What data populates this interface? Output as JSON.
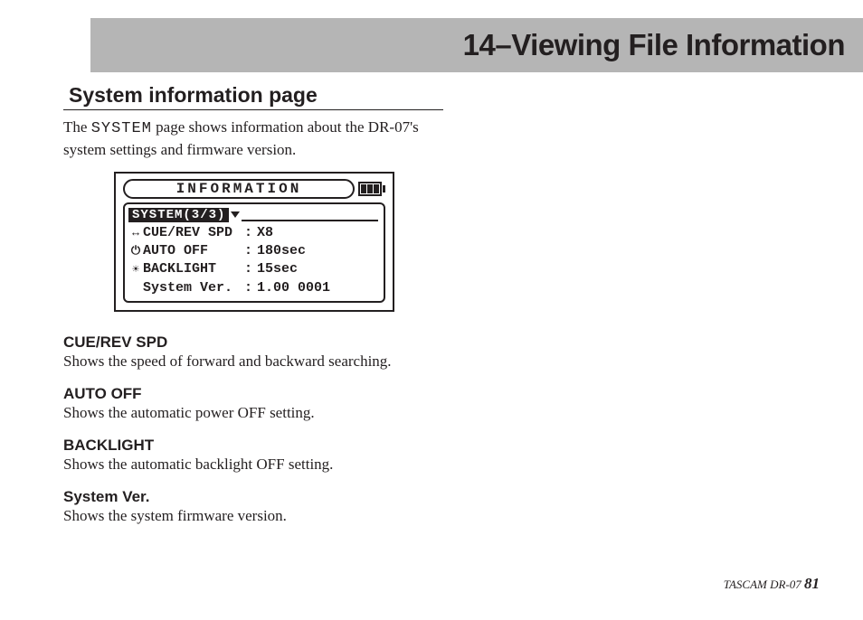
{
  "chapter_title": "14–Viewing File Information",
  "section_heading": "System information page",
  "intro_before": "The ",
  "intro_mono": "SYSTEM",
  "intro_after": " page shows information about the DR-07's system settings and firmware version.",
  "lcd": {
    "title": "INFORMATION",
    "page_badge": "SYSTEM(3/3)",
    "rows": [
      {
        "icon": "↔",
        "label": "CUE/REV SPD",
        "value": "X8"
      },
      {
        "icon": "⏻",
        "label": "AUTO OFF",
        "value": "180sec"
      },
      {
        "icon": "☀",
        "label": "BACKLIGHT",
        "value": "15sec"
      },
      {
        "icon": "",
        "label": "System Ver.",
        "value": "1.00 0001"
      }
    ]
  },
  "definitions": [
    {
      "term": "CUE/REV SPD",
      "desc": "Shows the speed of forward and backward searching."
    },
    {
      "term": "AUTO OFF",
      "desc": "Shows the automatic power OFF setting."
    },
    {
      "term": "BACKLIGHT",
      "desc": "Shows the automatic backlight OFF setting."
    },
    {
      "term": "System Ver.",
      "desc": "Shows the system firmware version."
    }
  ],
  "footer_brand": "TASCAM  DR-07 ",
  "footer_page": "81"
}
